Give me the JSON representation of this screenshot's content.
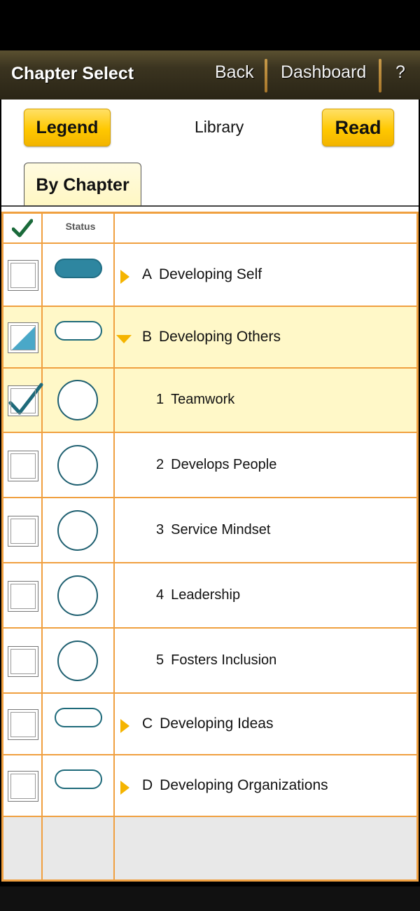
{
  "header": {
    "title": "Chapter Select",
    "back_label": "Back",
    "dashboard_label": "Dashboard",
    "help_label": "?"
  },
  "toolbar": {
    "legend_label": "Legend",
    "library_label": "Library",
    "read_label": "Read"
  },
  "tabs": {
    "by_chapter_label": "By Chapter"
  },
  "table": {
    "check_header_icon": "checkmark-icon",
    "status_header": "Status",
    "rows": [
      {
        "kind": "section",
        "letter": "A",
        "title": "Developing Self",
        "status": "complete",
        "check": "none",
        "expanded": false
      },
      {
        "kind": "section",
        "letter": "B",
        "title": "Developing Others",
        "status": "not-started",
        "check": "partial",
        "expanded": true
      },
      {
        "kind": "item",
        "number": "1",
        "title": "Teamwork",
        "status": "not-started",
        "check": "checked"
      },
      {
        "kind": "item",
        "number": "2",
        "title": "Develops People",
        "status": "not-started",
        "check": "none"
      },
      {
        "kind": "item",
        "number": "3",
        "title": "Service Mindset",
        "status": "not-started",
        "check": "none"
      },
      {
        "kind": "item",
        "number": "4",
        "title": "Leadership",
        "status": "not-started",
        "check": "none"
      },
      {
        "kind": "item",
        "number": "5",
        "title": "Fosters Inclusion",
        "status": "not-started",
        "check": "none"
      },
      {
        "kind": "section",
        "letter": "C",
        "title": "Developing Ideas",
        "status": "not-started",
        "check": "none",
        "expanded": false
      },
      {
        "kind": "section",
        "letter": "D",
        "title": "Developing Organizations",
        "status": "not-started",
        "check": "none",
        "expanded": false
      }
    ]
  },
  "colors": {
    "accent_yellow": "#ffc800",
    "grid_orange": "#f0a040",
    "status_teal": "#2e86a0",
    "highlight_row": "#fff8c8",
    "check_teal": "#1e6a7a"
  }
}
